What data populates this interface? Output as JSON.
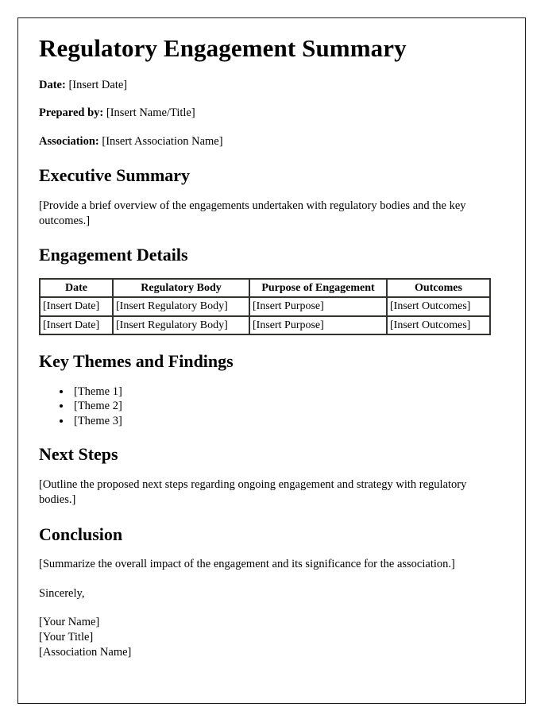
{
  "document": {
    "title": "Regulatory Engagement Summary",
    "meta": [
      {
        "label": "Date:",
        "value": "[Insert Date]"
      },
      {
        "label": "Prepared by:",
        "value": "[Insert Name/Title]"
      },
      {
        "label": "Association:",
        "value": "[Insert Association Name]"
      }
    ],
    "sections": {
      "executive_summary": {
        "heading": "Executive Summary",
        "body": "[Provide a brief overview of the engagements undertaken with regulatory bodies and the key outcomes.]"
      },
      "engagement_details": {
        "heading": "Engagement Details",
        "table": {
          "columns": [
            "Date",
            "Regulatory Body",
            "Purpose of Engagement",
            "Outcomes"
          ],
          "rows": [
            [
              "[Insert Date]",
              "[Insert Regulatory Body]",
              "[Insert Purpose]",
              "[Insert Outcomes]"
            ],
            [
              "[Insert Date]",
              "[Insert Regulatory Body]",
              "[Insert Purpose]",
              "[Insert Outcomes]"
            ]
          ]
        }
      },
      "key_themes": {
        "heading": "Key Themes and Findings",
        "items": [
          "[Theme 1]",
          "[Theme 2]",
          "[Theme 3]"
        ]
      },
      "next_steps": {
        "heading": "Next Steps",
        "body": "[Outline the proposed next steps regarding ongoing engagement and strategy with regulatory bodies.]"
      },
      "conclusion": {
        "heading": "Conclusion",
        "body": "[Summarize the overall impact of the engagement and its significance for the association.]"
      }
    },
    "closing": {
      "salutation": "Sincerely,",
      "signature_lines": [
        "[Your Name]",
        "[Your Title]",
        "[Association Name]"
      ]
    }
  },
  "colors": {
    "text": "#000000",
    "page_border": "#1c1c1c",
    "table_border": "#33332f",
    "background": "#ffffff"
  }
}
